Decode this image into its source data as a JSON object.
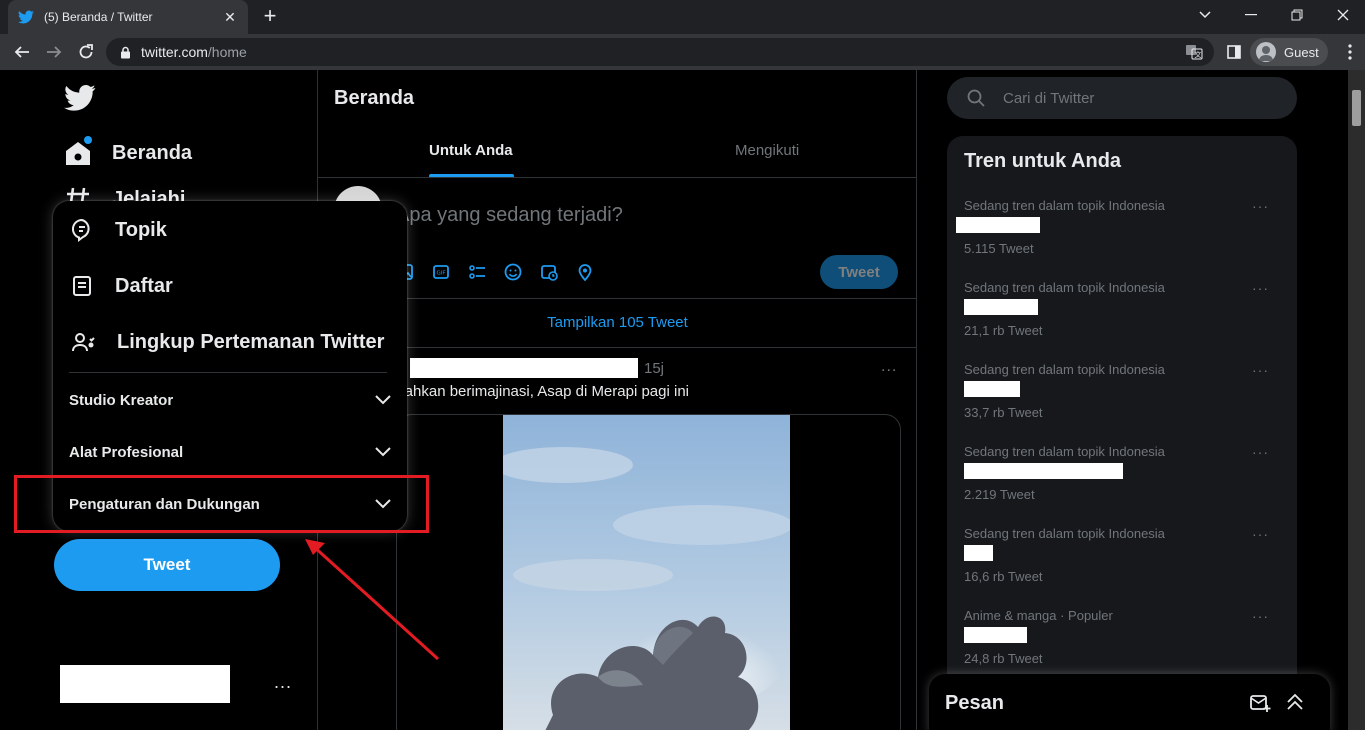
{
  "browser": {
    "tab_title": "(5) Beranda / Twitter",
    "url_domain": "twitter.com",
    "url_path": "/home",
    "profile_label": "Guest"
  },
  "sidebar": {
    "items": [
      {
        "label": "Beranda",
        "icon": "home-icon"
      },
      {
        "label": "Jelajahi",
        "icon": "hashtag-icon"
      }
    ],
    "tweet_button": "Tweet",
    "account_more": "..."
  },
  "popup_menu": {
    "items": [
      {
        "label": "Topik",
        "icon": "topic-icon"
      },
      {
        "label": "Daftar",
        "icon": "list-icon"
      },
      {
        "label": "Lingkup Pertemanan Twitter",
        "icon": "circle-people-icon"
      }
    ],
    "accordions": [
      {
        "label": "Studio Kreator"
      },
      {
        "label": "Alat Profesional"
      },
      {
        "label": "Pengaturan dan Dukungan"
      }
    ]
  },
  "main": {
    "title": "Beranda",
    "tabs": [
      {
        "label": "Untuk Anda",
        "active": true
      },
      {
        "label": "Mengikuti",
        "active": false
      }
    ],
    "compose_placeholder": "Apa yang sedang terjadi?",
    "compose_button": "Tweet",
    "show_more": "Tampilkan 105 Tweet",
    "post": {
      "time": "15j",
      "text": "ilahkan berimajinasi, Asap di Merapi pagi ini",
      "more": "..."
    }
  },
  "right": {
    "search_placeholder": "Cari di Twitter",
    "trends_title": "Tren untuk Anda",
    "trends": [
      {
        "context": "Sedang tren dalam topik Indonesia",
        "count": "5.115 Tweet"
      },
      {
        "context": "Sedang tren dalam topik Indonesia",
        "count": "21,1 rb Tweet"
      },
      {
        "context": "Sedang tren dalam topik Indonesia",
        "count": "33,7 rb Tweet"
      },
      {
        "context": "Sedang tren dalam topik Indonesia",
        "count": "2.219 Tweet"
      },
      {
        "context": "Sedang tren dalam topik Indonesia",
        "count": "16,6 rb Tweet"
      },
      {
        "context": "Anime & manga · Populer",
        "count": "24,8 rb Tweet"
      }
    ],
    "messages_title": "Pesan"
  },
  "colors": {
    "accent": "#1d9bf0",
    "background": "#000000",
    "highlight": "#e31b23"
  }
}
